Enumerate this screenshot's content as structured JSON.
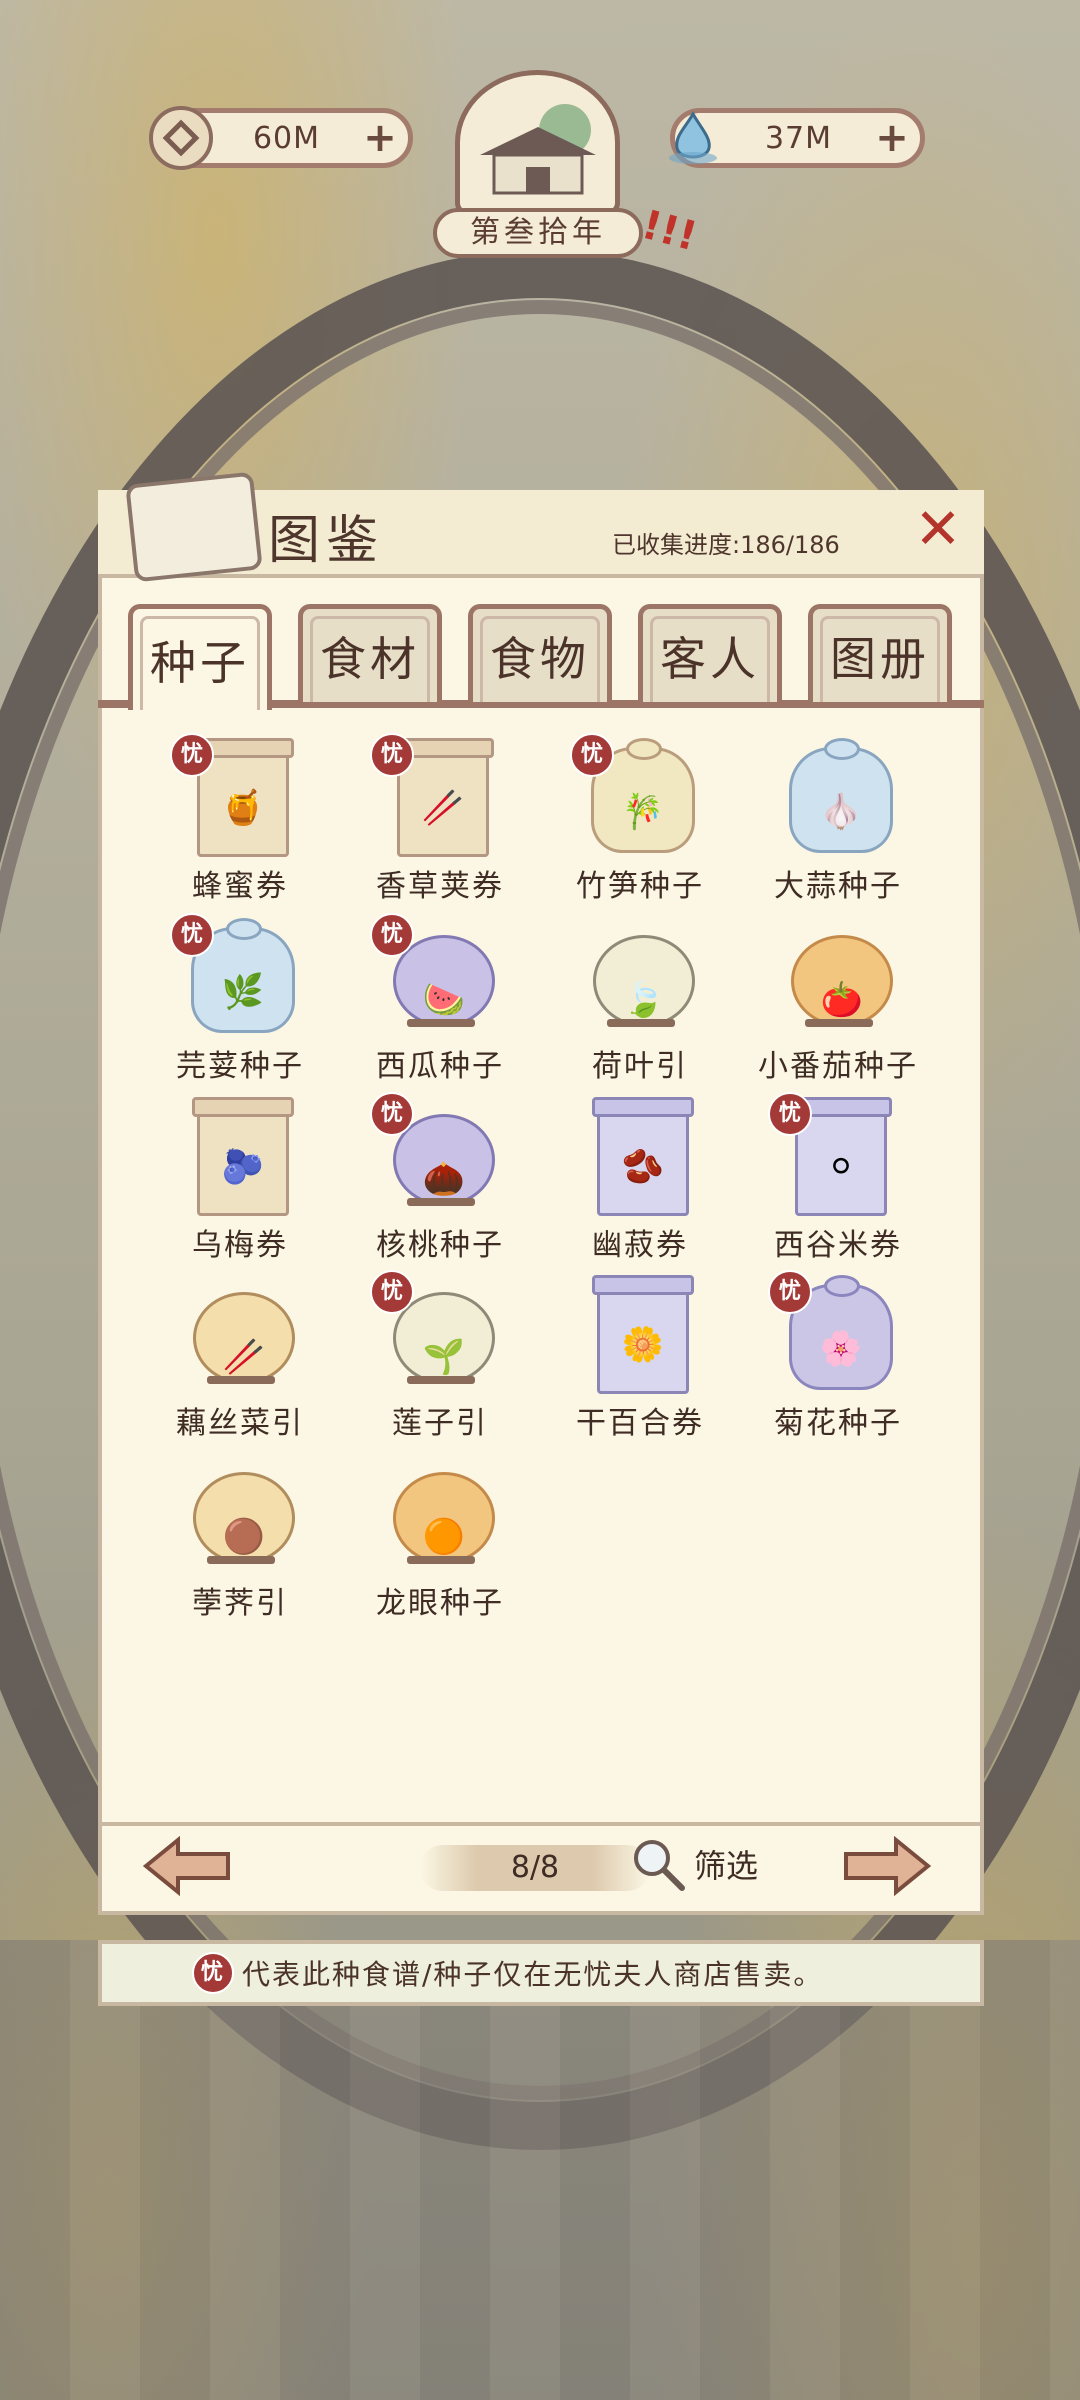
{
  "topbar": {
    "coins": "60M",
    "water": "37M",
    "year": "第叁拾年"
  },
  "panel": {
    "title": "图鉴",
    "progress": "已收集进度:186/186",
    "close_glyph": "✕"
  },
  "tabs": [
    {
      "label": "种子"
    },
    {
      "label": "食材"
    },
    {
      "label": "食物"
    },
    {
      "label": "客人"
    },
    {
      "label": "图册"
    }
  ],
  "items": [
    {
      "label": "蜂蜜券",
      "stamp": true,
      "kind": "ticket",
      "glyph": "🍯"
    },
    {
      "label": "香草荚券",
      "stamp": true,
      "kind": "ticket",
      "glyph": "🥢"
    },
    {
      "label": "竹笋种子",
      "stamp": true,
      "kind": "bag",
      "glyph": "🎋"
    },
    {
      "label": "大蒜种子",
      "stamp": false,
      "kind": "bag-blue",
      "glyph": "🧄"
    },
    {
      "label": "芫荽种子",
      "stamp": true,
      "kind": "bag-blue",
      "glyph": "🌿"
    },
    {
      "label": "西瓜种子",
      "stamp": true,
      "kind": "orb-purple",
      "glyph": "🍉"
    },
    {
      "label": "荷叶引",
      "stamp": false,
      "kind": "orb-clear",
      "glyph": "🍃"
    },
    {
      "label": "小番茄种子",
      "stamp": false,
      "kind": "orb-orange",
      "glyph": "🍅"
    },
    {
      "label": "乌梅券",
      "stamp": false,
      "kind": "ticket",
      "glyph": "🫐"
    },
    {
      "label": "核桃种子",
      "stamp": true,
      "kind": "orb-purple",
      "glyph": "🌰"
    },
    {
      "label": "幽菽券",
      "stamp": false,
      "kind": "ticket-purple",
      "glyph": "🫘"
    },
    {
      "label": "西谷米券",
      "stamp": true,
      "kind": "ticket-purple",
      "glyph": "⚪"
    },
    {
      "label": "藕丝菜引",
      "stamp": false,
      "kind": "orb-amber",
      "glyph": "🥢"
    },
    {
      "label": "莲子引",
      "stamp": true,
      "kind": "orb-clear",
      "glyph": "🌱"
    },
    {
      "label": "干百合券",
      "stamp": false,
      "kind": "ticket-purple",
      "glyph": "🌼"
    },
    {
      "label": "菊花种子",
      "stamp": true,
      "kind": "bag-purple",
      "glyph": "🌸"
    },
    {
      "label": "荸荠引",
      "stamp": false,
      "kind": "orb-amber",
      "glyph": "🟤"
    },
    {
      "label": "龙眼种子",
      "stamp": false,
      "kind": "orb-orange",
      "glyph": "🟠"
    }
  ],
  "stamp_glyph": "忧",
  "pager": {
    "page": "8/8",
    "filter_label": "筛选"
  },
  "footer_note": "代表此种食谱/种子仅在无忧夫人商店售卖。",
  "colors": {
    "panel_bg": "#fbf7e4",
    "frame": "#9c7566",
    "stamp": "#a33a37",
    "close": "#b3342a"
  }
}
